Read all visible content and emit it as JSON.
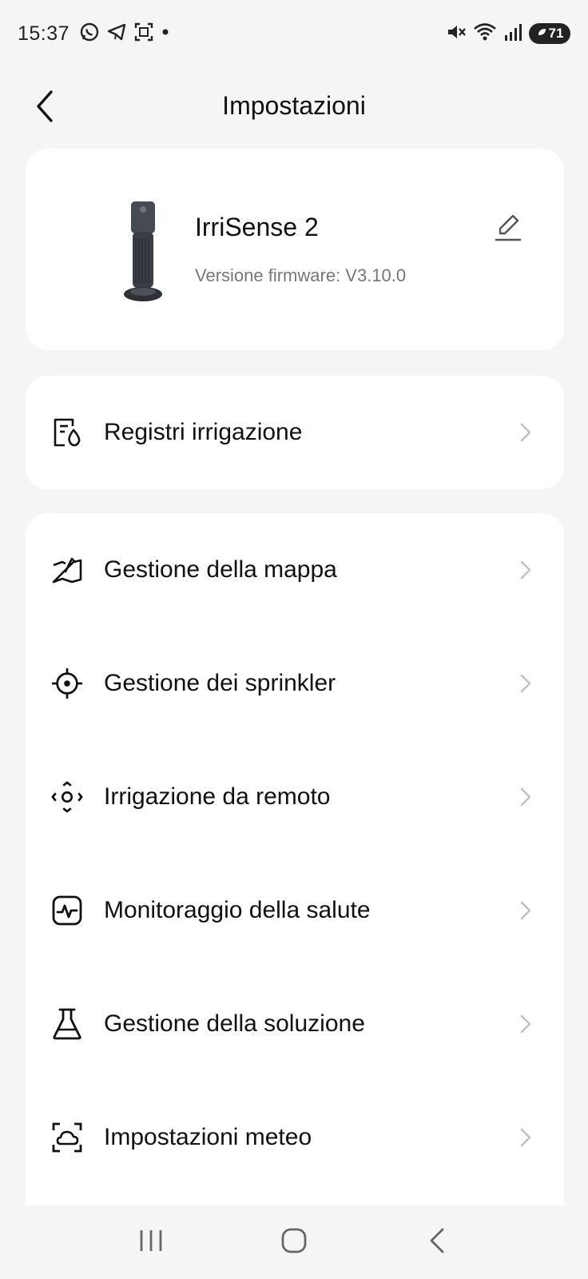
{
  "status_bar": {
    "time": "15:37",
    "left_icons": [
      "whatsapp-icon",
      "telegram-icon",
      "gallery-icon",
      "dot-icon"
    ],
    "right_icons": [
      "mute-icon",
      "wifi-icon",
      "signal-icon"
    ],
    "battery": "71"
  },
  "header": {
    "title": "Impostazioni",
    "back_icon": "back-arrow-icon"
  },
  "device": {
    "name": "IrriSense 2",
    "firmware": "Versione firmware: V3.10.0",
    "edit_icon": "edit-pencil-icon"
  },
  "logs": {
    "label": "Registri irrigazione",
    "icon": "irrigation-log-icon"
  },
  "menu": [
    {
      "label": "Gestione della mappa",
      "icon": "map-icon"
    },
    {
      "label": "Gestione dei sprinkler",
      "icon": "crosshair-icon"
    },
    {
      "label": "Irrigazione da remoto",
      "icon": "remote-control-icon"
    },
    {
      "label": "Monitoraggio della salute",
      "icon": "health-monitor-icon"
    },
    {
      "label": "Gestione della soluzione",
      "icon": "flask-icon"
    },
    {
      "label": "Impostazioni meteo",
      "icon": "weather-icon"
    }
  ],
  "nav": [
    "recent-apps-icon",
    "home-icon",
    "back-icon"
  ],
  "colors": {
    "background": "#f4f5f5",
    "card": "#ffffff",
    "text": "#111111",
    "secondary_text": "#777777",
    "chevron": "#c2c2c2"
  }
}
